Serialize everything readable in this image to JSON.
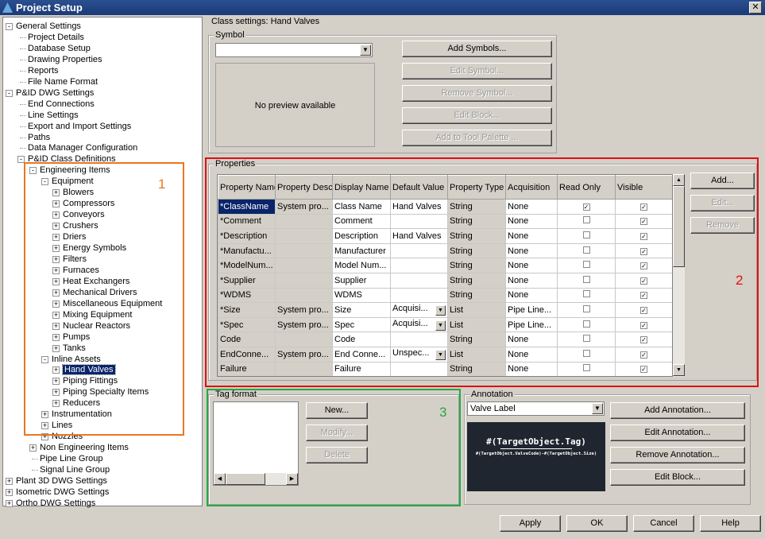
{
  "window": {
    "title": "Project Setup",
    "close": "✕"
  },
  "tree": [
    {
      "label": "General Settings",
      "level": 0,
      "exp": "-"
    },
    {
      "label": "Project Details",
      "level": 1
    },
    {
      "label": "Database Setup",
      "level": 1
    },
    {
      "label": "Drawing Properties",
      "level": 1
    },
    {
      "label": "Reports",
      "level": 1
    },
    {
      "label": "File Name Format",
      "level": 1
    },
    {
      "label": "P&ID DWG Settings",
      "level": 0,
      "exp": "-"
    },
    {
      "label": "End Connections",
      "level": 1
    },
    {
      "label": "Line Settings",
      "level": 1
    },
    {
      "label": "Export and Import Settings",
      "level": 1
    },
    {
      "label": "Paths",
      "level": 1
    },
    {
      "label": "Data Manager Configuration",
      "level": 1
    },
    {
      "label": "P&ID Class Definitions",
      "level": 1,
      "exp": "-"
    },
    {
      "label": "Engineering Items",
      "level": 2,
      "exp": "-"
    },
    {
      "label": "Equipment",
      "level": 3,
      "exp": "-"
    },
    {
      "label": "Blowers",
      "level": 4,
      "exp": "+"
    },
    {
      "label": "Compressors",
      "level": 4,
      "exp": "+"
    },
    {
      "label": "Conveyors",
      "level": 4,
      "exp": "+"
    },
    {
      "label": "Crushers",
      "level": 4,
      "exp": "+"
    },
    {
      "label": "Driers",
      "level": 4,
      "exp": "+"
    },
    {
      "label": "Energy Symbols",
      "level": 4,
      "exp": "+"
    },
    {
      "label": "Filters",
      "level": 4,
      "exp": "+"
    },
    {
      "label": "Furnaces",
      "level": 4,
      "exp": "+"
    },
    {
      "label": "Heat Exchangers",
      "level": 4,
      "exp": "+"
    },
    {
      "label": "Mechanical Drivers",
      "level": 4,
      "exp": "+"
    },
    {
      "label": "Miscellaneous Equipment",
      "level": 4,
      "exp": "+"
    },
    {
      "label": "Mixing Equipment",
      "level": 4,
      "exp": "+"
    },
    {
      "label": "Nuclear Reactors",
      "level": 4,
      "exp": "+"
    },
    {
      "label": "Pumps",
      "level": 4,
      "exp": "+"
    },
    {
      "label": "Tanks",
      "level": 4,
      "exp": "+"
    },
    {
      "label": "Inline Assets",
      "level": 3,
      "exp": "-"
    },
    {
      "label": "Hand Valves",
      "level": 4,
      "exp": "+",
      "selected": true
    },
    {
      "label": "Piping Fittings",
      "level": 4,
      "exp": "+"
    },
    {
      "label": "Piping Specialty Items",
      "level": 4,
      "exp": "+"
    },
    {
      "label": "Reducers",
      "level": 4,
      "exp": "+"
    },
    {
      "label": "Instrumentation",
      "level": 3,
      "exp": "+"
    },
    {
      "label": "Lines",
      "level": 3,
      "exp": "+"
    },
    {
      "label": "Nozzles",
      "level": 3,
      "exp": "+"
    },
    {
      "label": "Non Engineering Items",
      "level": 2,
      "exp": "+"
    },
    {
      "label": "Pipe Line Group",
      "level": 2
    },
    {
      "label": "Signal Line Group",
      "level": 2
    },
    {
      "label": "Plant 3D DWG Settings",
      "level": 0,
      "exp": "+"
    },
    {
      "label": "Isometric DWG Settings",
      "level": 0,
      "exp": "+"
    },
    {
      "label": "Ortho DWG Settings",
      "level": 0,
      "exp": "+"
    }
  ],
  "class_settings": {
    "title": "Class settings: Hand Valves"
  },
  "symbol": {
    "label": "Symbol",
    "value": "",
    "preview": "No preview available",
    "buttons": [
      {
        "label": "Add Symbols...",
        "enabled": true
      },
      {
        "label": "Edit Symbol...",
        "enabled": false
      },
      {
        "label": "Remove Symbol...",
        "enabled": false
      },
      {
        "label": "Edit Block...",
        "enabled": false
      },
      {
        "label": "Add to Tool Palette ...",
        "enabled": false
      }
    ]
  },
  "properties": {
    "label": "Properties",
    "columns": [
      "Property Name",
      "Property Description",
      "Display Name",
      "Default Value",
      "Property Type",
      "Acquisition",
      "Read Only",
      "Visible"
    ],
    "rows": [
      {
        "name": "*ClassName",
        "desc": "System pro...",
        "display": "Class Name",
        "default": "Hand Valves",
        "type": "String",
        "acq": "None",
        "readonly": true,
        "visible": true,
        "dd": false
      },
      {
        "name": "*Comment",
        "desc": "",
        "display": "Comment",
        "default": "",
        "type": "String",
        "acq": "None",
        "readonly": false,
        "visible": true,
        "dd": false
      },
      {
        "name": "*Description",
        "desc": "",
        "display": "Description",
        "default": "Hand Valves",
        "type": "String",
        "acq": "None",
        "readonly": false,
        "visible": true,
        "dd": false
      },
      {
        "name": "*Manufactu...",
        "desc": "",
        "display": "Manufacturer",
        "default": "",
        "type": "String",
        "acq": "None",
        "readonly": false,
        "visible": true,
        "dd": false
      },
      {
        "name": "*ModelNum...",
        "desc": "",
        "display": "Model Num...",
        "default": "",
        "type": "String",
        "acq": "None",
        "readonly": false,
        "visible": true,
        "dd": false
      },
      {
        "name": "*Supplier",
        "desc": "",
        "display": "Supplier",
        "default": "",
        "type": "String",
        "acq": "None",
        "readonly": false,
        "visible": true,
        "dd": false
      },
      {
        "name": "*WDMS",
        "desc": "",
        "display": "WDMS",
        "default": "",
        "type": "String",
        "acq": "None",
        "readonly": false,
        "visible": true,
        "dd": false
      },
      {
        "name": "*Size",
        "desc": "System pro...",
        "display": "Size",
        "default": "Acquisi...",
        "type": "List",
        "acq": "Pipe Line...",
        "readonly": false,
        "visible": true,
        "dd": true
      },
      {
        "name": "*Spec",
        "desc": "System pro...",
        "display": "Spec",
        "default": "Acquisi...",
        "type": "List",
        "acq": "Pipe Line...",
        "readonly": false,
        "visible": true,
        "dd": true
      },
      {
        "name": "Code",
        "desc": "",
        "display": "Code",
        "default": "",
        "type": "String",
        "acq": "None",
        "readonly": false,
        "visible": true,
        "dd": false
      },
      {
        "name": "EndConne...",
        "desc": "System pro...",
        "display": "End Conne...",
        "default": "Unspec...",
        "type": "List",
        "acq": "None",
        "readonly": false,
        "visible": true,
        "dd": true
      },
      {
        "name": "Failure",
        "desc": "",
        "display": "Failure",
        "default": "",
        "type": "String",
        "acq": "None",
        "readonly": false,
        "visible": true,
        "dd": false
      }
    ],
    "buttons": [
      {
        "label": "Add...",
        "enabled": true
      },
      {
        "label": "Edit...",
        "enabled": false
      },
      {
        "label": "Remove",
        "enabled": false
      }
    ]
  },
  "tag_format": {
    "label": "Tag format",
    "buttons": [
      {
        "label": "New...",
        "enabled": true
      },
      {
        "label": "Modify...",
        "enabled": false
      },
      {
        "label": "Delete",
        "enabled": false
      }
    ]
  },
  "annotation": {
    "label": "Annotation",
    "value": "Valve Label",
    "preview_line1": "#(TargetObject.Tag)",
    "preview_line2": "#(TargetObject.ValveCode)-#(TargetObject.Size)",
    "buttons": [
      {
        "label": "Add Annotation..."
      },
      {
        "label": "Edit Annotation..."
      },
      {
        "label": "Remove Annotation..."
      },
      {
        "label": "Edit Block..."
      }
    ]
  },
  "footer": {
    "apply": "Apply",
    "ok": "OK",
    "cancel": "Cancel",
    "help": "Help"
  },
  "callouts": [
    {
      "label": "1",
      "color": "#e87722"
    },
    {
      "label": "2",
      "color": "#e01010"
    },
    {
      "label": "3",
      "color": "#22aa44"
    }
  ]
}
